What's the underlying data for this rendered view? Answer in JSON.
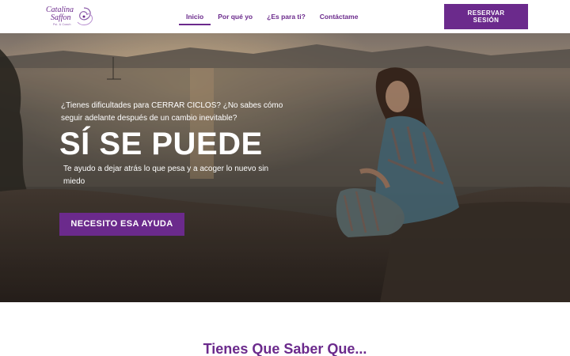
{
  "header": {
    "logo": {
      "line1": "Catalina",
      "line2": "Saffon",
      "tagline": "Psi. & Coach"
    },
    "nav": [
      {
        "label": "Inicio",
        "active": true
      },
      {
        "label": "Por qué yo",
        "active": false
      },
      {
        "label": "¿Es para ti?",
        "active": false
      },
      {
        "label": "Contáctame",
        "active": false
      }
    ],
    "cta": {
      "line1": "RESERVAR",
      "line2": "SESIÓN"
    }
  },
  "hero": {
    "pretitle": "¿Tienes dificultades para CERRAR CICLOS? ¿No sabes cómo seguir adelante después de un cambio inevitable?",
    "title": "SÍ SE PUEDE",
    "subtitle": "Te ayudo a dejar atrás lo que pesa y a acoger lo nuevo sin miedo",
    "button": "NECESITO ESA AYUDA",
    "image_icon": "woman-sitting-on-rocks-at-sunset-photo"
  },
  "section": {
    "title": "Tienes Que Saber Que..."
  },
  "colors": {
    "brand": "#6b2a8c",
    "white": "#ffffff"
  }
}
